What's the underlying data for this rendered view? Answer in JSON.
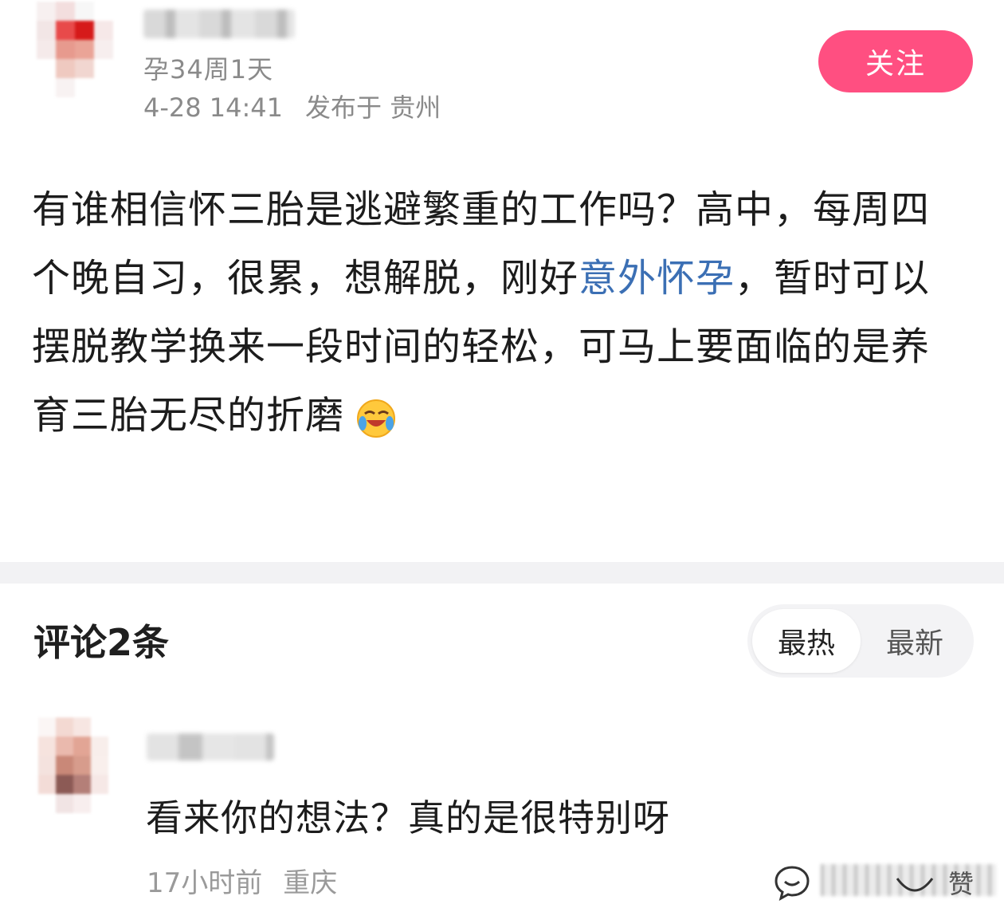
{
  "post": {
    "pregnancy_week": "孕34周1天",
    "date": "4-28 14:41",
    "location": "发布于 贵州",
    "follow_label": "关注",
    "body_text_1": "有谁相信怀三胎是逃避繁重的工作吗？高中，每周四个晚自习，很累，想解脱，刚好",
    "topic_link": "意外怀孕",
    "body_text_2": "，暂时可以摆脱教学换来一段时间的轻松，可马上要面临的是养育三胎无尽的折磨",
    "emoji": "crying-laughing-emoji"
  },
  "comments": {
    "title": "评论2条",
    "sort_options": [
      "最热",
      "最新"
    ],
    "active_sort": "最热",
    "items": [
      {
        "text": "看来你的想法？真的是很特别呀",
        "time": "17小时前",
        "location": "重庆",
        "like_count": "赞"
      }
    ]
  },
  "colors": {
    "follow_button": "#ff4f81",
    "topic_link": "#3b6fb4",
    "divider": "#f2f2f4"
  }
}
